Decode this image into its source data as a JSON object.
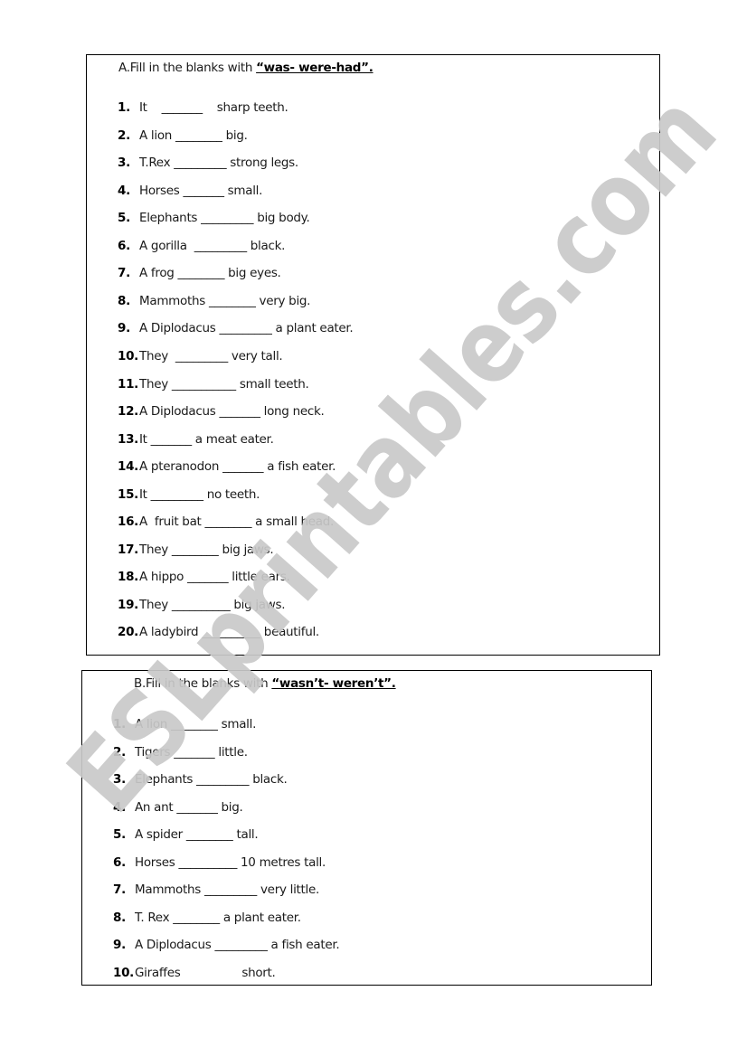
{
  "sectionA": {
    "instruction_prefix": "A.Fill in the blanks with ",
    "instruction_words": "“was- were-had”.",
    "items": [
      {
        "num": "1.",
        "text": "It    _______    sharp teeth."
      },
      {
        "num": "2.",
        "text": "A lion ________ big."
      },
      {
        "num": "3.",
        "text": "T.Rex _________ strong legs."
      },
      {
        "num": "4.",
        "text": "Horses _______ small."
      },
      {
        "num": "5.",
        "text": "Elephants _________ big body."
      },
      {
        "num": "6.",
        "text": "A gorilla  _________ black."
      },
      {
        "num": "7.",
        "text": "A frog ________ big eyes."
      },
      {
        "num": "8.",
        "text": "Mammoths ________ very big."
      },
      {
        "num": "9.",
        "text": "A Diplodacus _________ a plant eater."
      },
      {
        "num": "10.",
        "text": "They  _________ very tall."
      },
      {
        "num": "11.",
        "text": "They ___________ small teeth."
      },
      {
        "num": "12.",
        "text": "A Diplodacus _______ long neck."
      },
      {
        "num": "13.",
        "text": "It _______ a meat eater."
      },
      {
        "num": "14.",
        "text": "A pteranodon _______ a fish eater."
      },
      {
        "num": "15.",
        "text": "It _________ no teeth."
      },
      {
        "num": "16.",
        "text": "A  fruit bat ________ a small head."
      },
      {
        "num": "17.",
        "text": "They ________ big jaws."
      },
      {
        "num": "18.",
        "text": "A hippo _______ little ears."
      },
      {
        "num": "19.",
        "text": "They __________ big jaws."
      },
      {
        "num": "20.",
        "text": "A ladybird __________ beautiful."
      }
    ]
  },
  "sectionB": {
    "instruction_prefix": "B.Fill in the blanks with ",
    "instruction_words": "“wasn’t- weren’t”.",
    "items": [
      {
        "num": "1.",
        "text": "A lion ________ small."
      },
      {
        "num": "2.",
        "text": "Tigers _______ little."
      },
      {
        "num": "3.",
        "text": "Elephants _________ black."
      },
      {
        "num": "4.",
        "text": "An ant _______ big."
      },
      {
        "num": "5.",
        "text": "A spider ________ tall."
      },
      {
        "num": "6.",
        "text": "Horses __________ 10 metres tall."
      },
      {
        "num": "7.",
        "text": "Mammoths _________ very little."
      },
      {
        "num": "8.",
        "text": "T. Rex ________ a plant eater."
      },
      {
        "num": "9.",
        "text": "A Diplodacus _________ a fish eater."
      },
      {
        "num": "10.",
        "text": "Giraffes                 short."
      }
    ]
  },
  "watermark": {
    "text": "ESLprintables.com",
    "color": "#c9c9c9"
  }
}
